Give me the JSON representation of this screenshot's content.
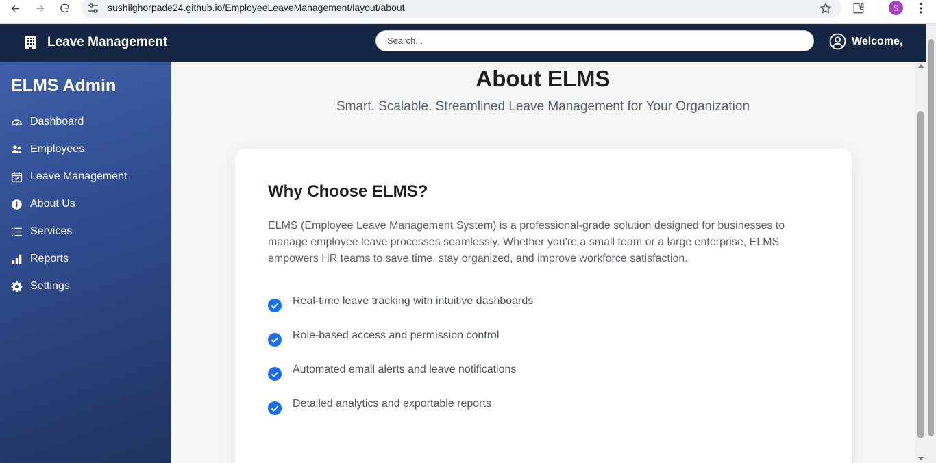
{
  "browser": {
    "url": "sushilghorpade24.github.io/EmployeeLeaveManagement/layout/about",
    "profile_initial": "S"
  },
  "topbar": {
    "brand": "Leave Management",
    "search_placeholder": "Search...",
    "welcome": "Welcome,"
  },
  "sidebar": {
    "title": "ELMS Admin",
    "items": [
      {
        "label": "Dashboard",
        "icon": "gauge-icon"
      },
      {
        "label": "Employees",
        "icon": "users-icon"
      },
      {
        "label": "Leave Management",
        "icon": "calendar-check-icon"
      },
      {
        "label": "About Us",
        "icon": "info-icon"
      },
      {
        "label": "Services",
        "icon": "list-icon"
      },
      {
        "label": "Reports",
        "icon": "bar-chart-icon"
      },
      {
        "label": "Settings",
        "icon": "gear-icon"
      }
    ]
  },
  "main": {
    "title": "About ELMS",
    "subtitle": "Smart. Scalable. Streamlined Leave Management for Your Organization",
    "card": {
      "heading": "Why Choose ELMS?",
      "description": "ELMS (Employee Leave Management System) is a professional-grade solution designed for businesses to manage employee leave processes seamlessly. Whether you're a small team or a large enterprise, ELMS empowers HR teams to save time, stay organized, and improve workforce satisfaction.",
      "features": [
        "Real-time leave tracking with intuitive dashboards",
        "Role-based access and permission control",
        "Automated email alerts and leave notifications",
        "Detailed analytics and exportable reports"
      ]
    }
  },
  "colors": {
    "topbar_bg": "#152644",
    "sidebar_gradient_start": "#3e5fa9",
    "sidebar_gradient_end": "#1f335f",
    "check_blue": "#1a6ef0"
  }
}
